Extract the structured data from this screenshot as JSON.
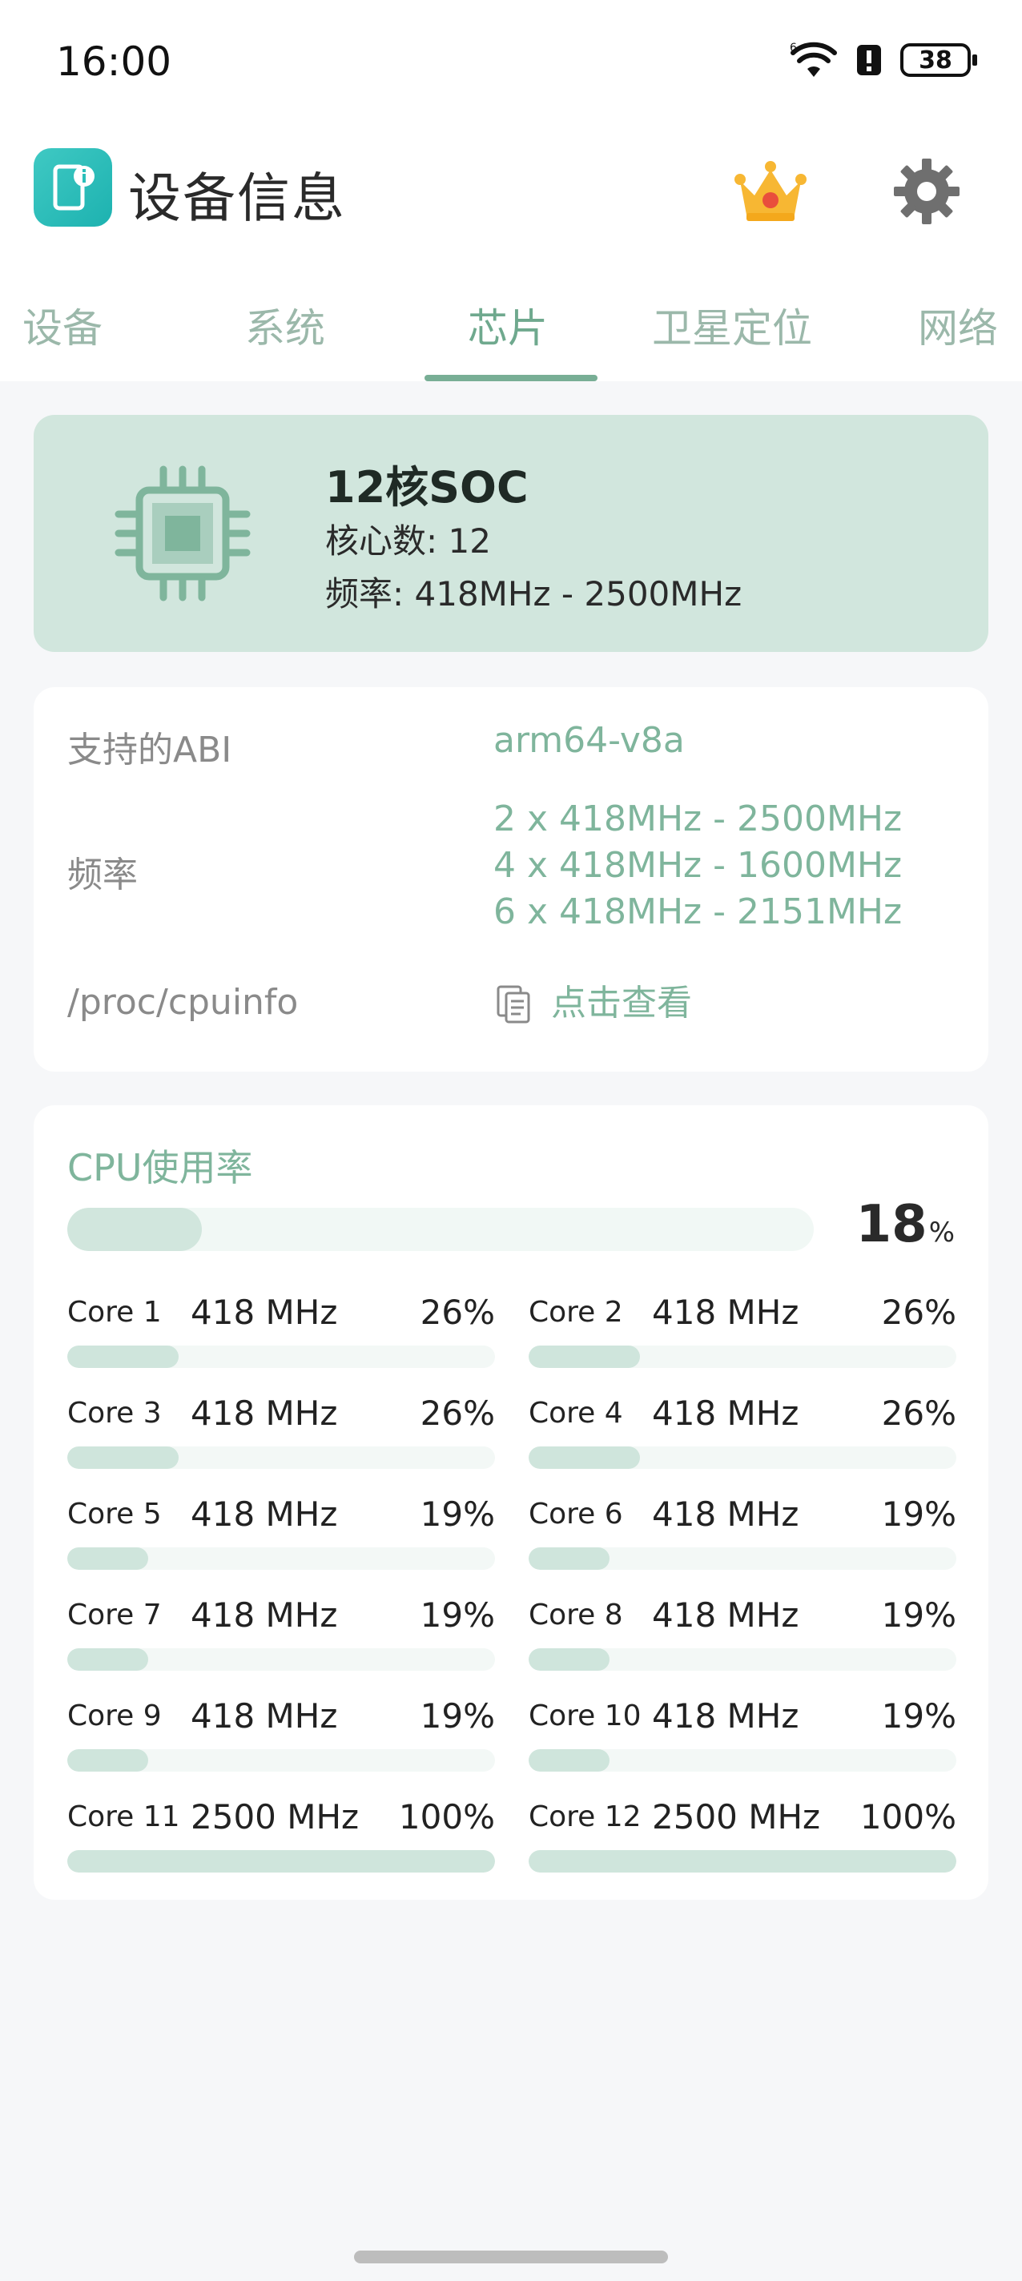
{
  "status_bar": {
    "time": "16:00",
    "battery": "38",
    "icons": [
      "wifi-icon",
      "alert-icon",
      "battery-icon"
    ]
  },
  "app": {
    "title": "设备信息",
    "logo_icon": "device-info-icon",
    "actions": [
      "crown-icon",
      "gear-icon"
    ]
  },
  "tabs": [
    {
      "label": "设备",
      "active": false
    },
    {
      "label": "系统",
      "active": false
    },
    {
      "label": "芯片",
      "active": true
    },
    {
      "label": "卫星定位",
      "active": false
    },
    {
      "label": "网络",
      "active": false
    }
  ],
  "soc": {
    "title": "12核SOC",
    "cores_line": "核心数: 12",
    "freq_line": "频率: 418MHz - 2500MHz",
    "icon": "chip-icon"
  },
  "info": {
    "abi_label": "支持的ABI",
    "abi_value": "arm64-v8a",
    "freq_label": "频率",
    "freq_values": [
      "2 x 418MHz - 2500MHz",
      "4 x 418MHz - 1600MHz",
      "6 x 418MHz - 2151MHz"
    ],
    "cpuinfo_label": "/proc/cpuinfo",
    "cpuinfo_action": "点击查看"
  },
  "cpu_usage": {
    "title": "CPU使用率",
    "total_value": "18",
    "total_unit": "%",
    "total_fraction": 0.18,
    "cores": [
      {
        "name": "Core 1",
        "freq": "418 MHz",
        "percent": "26%",
        "fraction": 0.26
      },
      {
        "name": "Core 2",
        "freq": "418 MHz",
        "percent": "26%",
        "fraction": 0.26
      },
      {
        "name": "Core 3",
        "freq": "418 MHz",
        "percent": "26%",
        "fraction": 0.26
      },
      {
        "name": "Core 4",
        "freq": "418 MHz",
        "percent": "26%",
        "fraction": 0.26
      },
      {
        "name": "Core 5",
        "freq": "418 MHz",
        "percent": "19%",
        "fraction": 0.19
      },
      {
        "name": "Core 6",
        "freq": "418 MHz",
        "percent": "19%",
        "fraction": 0.19
      },
      {
        "name": "Core 7",
        "freq": "418 MHz",
        "percent": "19%",
        "fraction": 0.19
      },
      {
        "name": "Core 8",
        "freq": "418 MHz",
        "percent": "19%",
        "fraction": 0.19
      },
      {
        "name": "Core 9",
        "freq": "418 MHz",
        "percent": "19%",
        "fraction": 0.19
      },
      {
        "name": "Core 10",
        "freq": "418 MHz",
        "percent": "19%",
        "fraction": 0.19
      },
      {
        "name": "Core 11",
        "freq": "2500 MHz",
        "percent": "100%",
        "fraction": 1.0
      },
      {
        "name": "Core 12",
        "freq": "2500 MHz",
        "percent": "100%",
        "fraction": 1.0
      }
    ]
  },
  "colors": {
    "accent": "#7fb59c",
    "soc_bg": "#d1e6dd",
    "bar_fill": "#cfe5dc",
    "bar_track": "#f3f8f6",
    "logo": "#2bbfba"
  }
}
